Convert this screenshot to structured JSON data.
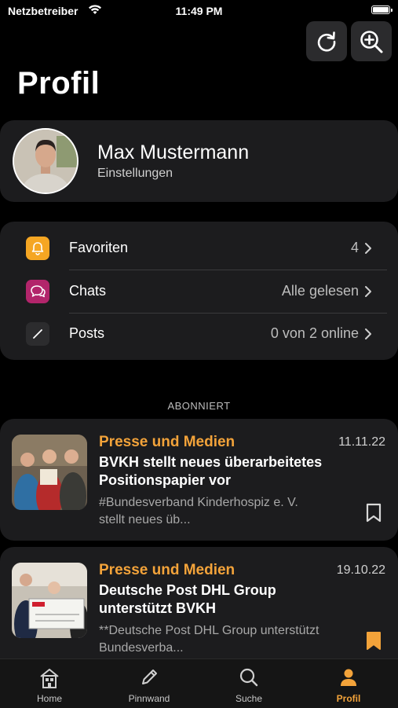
{
  "status_bar": {
    "carrier": "Netzbetreiber",
    "time": "11:49 PM"
  },
  "header": {
    "title": "Profil"
  },
  "profile": {
    "name": "Max Mustermann",
    "subtitle": "Einstellungen"
  },
  "menu": {
    "items": [
      {
        "label": "Favoriten",
        "value": "4",
        "icon": "bell-icon",
        "color": "#f5a623"
      },
      {
        "label": "Chats",
        "value": "Alle gelesen",
        "icon": "chat-icon",
        "color": "#b2256b"
      },
      {
        "label": "Posts",
        "value": "0 von 2 online",
        "icon": "pencil-icon",
        "color": "#2c2c2e"
      }
    ]
  },
  "section": {
    "subscribed_label": "ABONNIERT"
  },
  "news": [
    {
      "category": "Presse und Medien",
      "date": "11.11.22",
      "title_lines": [
        "BVKH stellt neues überarbeitetes",
        "Positionspapier vor"
      ],
      "desc_lines": [
        "#Bundesverband Kinderhospiz e. V.",
        "stellt neues üb..."
      ],
      "bookmarked": false
    },
    {
      "category": "Presse und Medien",
      "date": "19.10.22",
      "title_lines": [
        "Deutsche Post DHL Group",
        "unterstützt BVKH"
      ],
      "desc_lines": [
        "**Deutsche Post DHL Group unterstützt",
        "Bundesverba..."
      ],
      "bookmarked": true
    }
  ],
  "tabbar": {
    "items": [
      {
        "label": "Home",
        "icon": "home-icon"
      },
      {
        "label": "Pinnwand",
        "icon": "pencil-icon"
      },
      {
        "label": "Suche",
        "icon": "search-icon"
      },
      {
        "label": "Profil",
        "icon": "person-icon",
        "active": true
      }
    ]
  },
  "colors": {
    "accent": "#f3a33a",
    "card": "#1c1c1e",
    "background": "#000000"
  }
}
